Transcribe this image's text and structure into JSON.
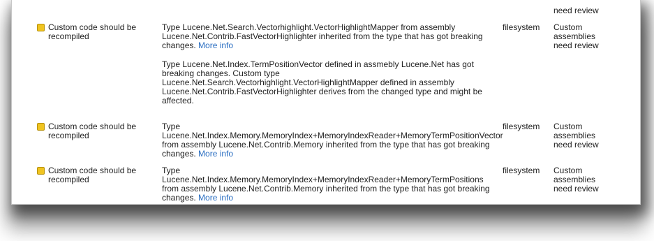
{
  "top_partial": {
    "category": "need review"
  },
  "rows": [
    {
      "status": "warning",
      "title": "Custom code should be recompiled",
      "messages": [
        {
          "text": "Type Lucene.Net.Search.Vectorhighlight.VectorHighlightMapper from assembly Lucene.Net.Contrib.FastVectorHighlighter inherited from the type that has got breaking changes.",
          "link": "More info"
        },
        {
          "text": "Type Lucene.Net.Index.TermPositionVector defined in assmebly Lucene.Net has got breaking changes. Custom type Lucene.Net.Search.Vectorhighlight.VectorHighlightMapper defined in assembly Lucene.Net.Contrib.FastVectorHighlighter derives from the changed type and might be affected.",
          "link": ""
        }
      ],
      "source": "filesystem",
      "category": "Custom assemblies need review"
    },
    {
      "status": "warning",
      "title": "Custom code should be recompiled",
      "messages": [
        {
          "text": "Type Lucene.Net.Index.Memory.MemoryIndex+MemoryIndexReader+MemoryTermPositionVector from assembly Lucene.Net.Contrib.Memory inherited from the type that has got breaking changes.",
          "link": "More info"
        }
      ],
      "source": "filesystem",
      "category": "Custom assemblies need review"
    },
    {
      "status": "warning",
      "title": "Custom code should be recompiled",
      "messages": [
        {
          "text": "Type Lucene.Net.Index.Memory.MemoryIndex+MemoryIndexReader+MemoryTermPositions from assembly Lucene.Net.Contrib.Memory inherited from the type that has got breaking changes.",
          "link": "More info"
        }
      ],
      "source": "filesystem",
      "category": "Custom assemblies need review"
    }
  ]
}
